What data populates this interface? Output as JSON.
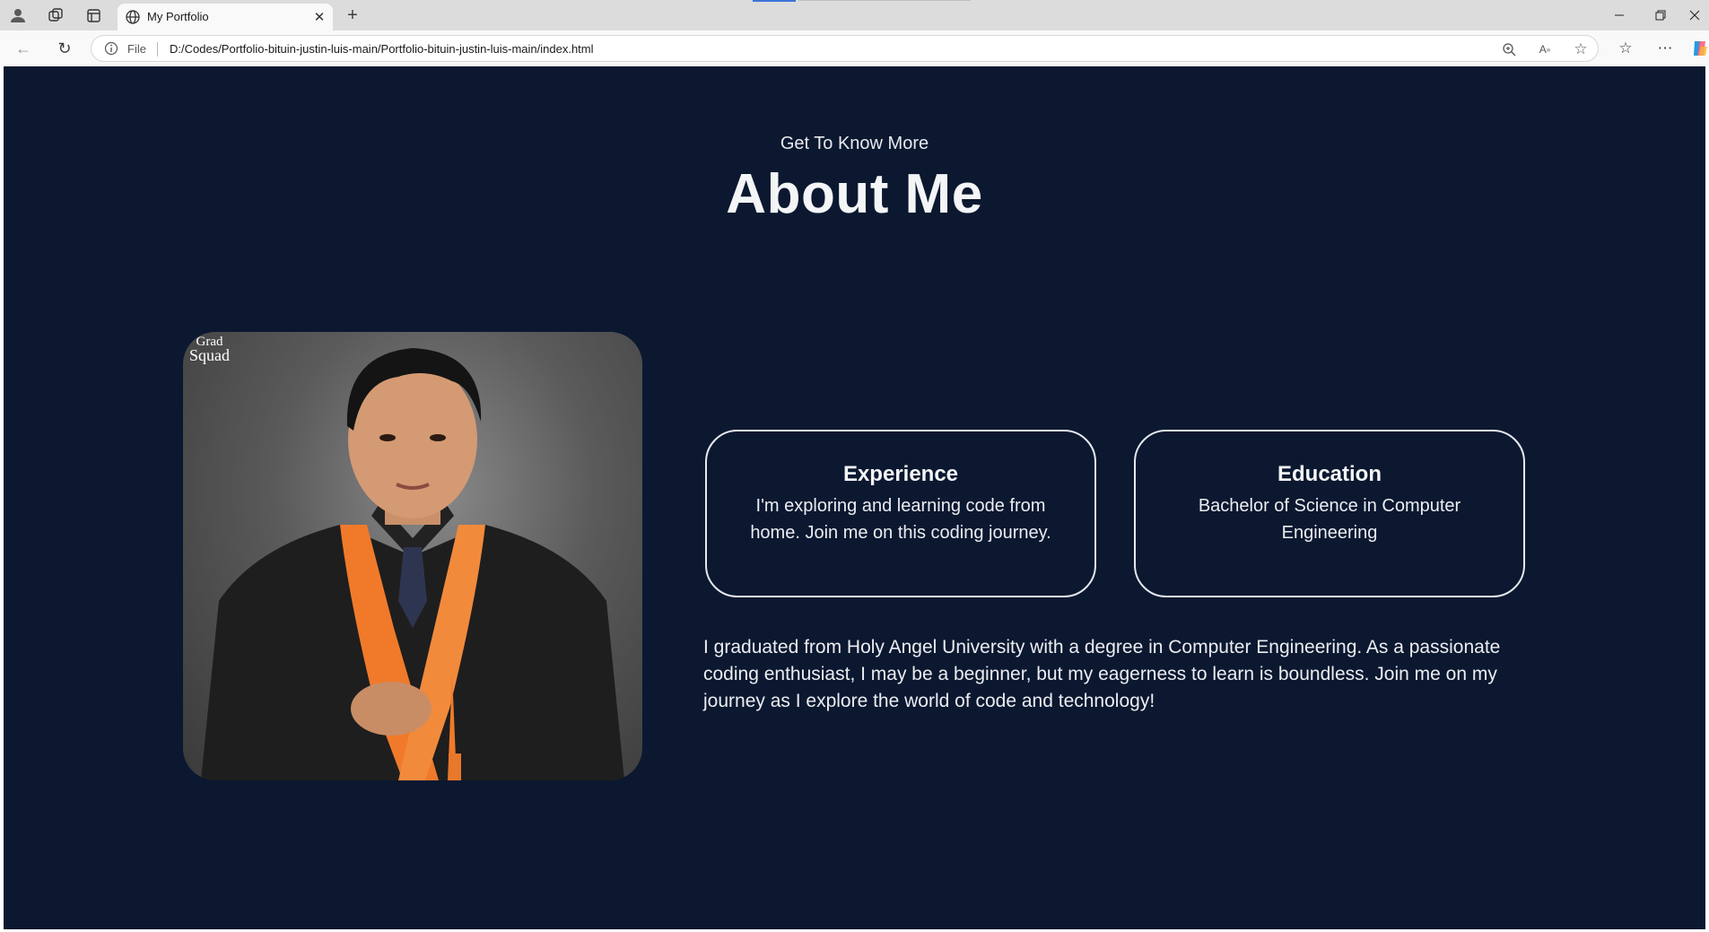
{
  "browser": {
    "tab_title": "My Portfolio",
    "address_scheme_label": "File",
    "url": "D:/Codes/Portfolio-bituin-justin-luis-main/Portfolio-bituin-justin-luis-main/index.html",
    "icons": [
      "profile-icon",
      "workspaces-icon",
      "tab-actions-icon",
      "globe-icon",
      "close-icon",
      "new-tab-icon",
      "minimize-icon",
      "restore-icon",
      "window-close-icon",
      "back-icon",
      "reload-icon",
      "info-icon",
      "zoom-icon",
      "read-aloud-icon",
      "favorite-star-icon",
      "favorites-icon",
      "more-icon",
      "copilot-icon"
    ]
  },
  "about": {
    "subtitle": "Get To Know More",
    "title": "About Me",
    "portrait_watermark_line1": "Grad",
    "portrait_watermark_line2": "Squad",
    "cards": [
      {
        "title": "Experience",
        "text": "I'm exploring and learning code from home. Join me on this coding journey."
      },
      {
        "title": "Education",
        "text": "Bachelor of Science in Computer Engineering"
      }
    ],
    "bio": "I graduated from Holy Angel University with a degree in Computer Engineering. As a passionate coding enthusiast, I may be a beginner, but my eagerness to learn is boundless. Join me on my journey as I explore the world of code and technology!"
  },
  "colors": {
    "page_background": "#0b1830",
    "text": "#ecedf1",
    "card_border": "#e6e8ee",
    "gown_orange": "#f07a2a"
  }
}
